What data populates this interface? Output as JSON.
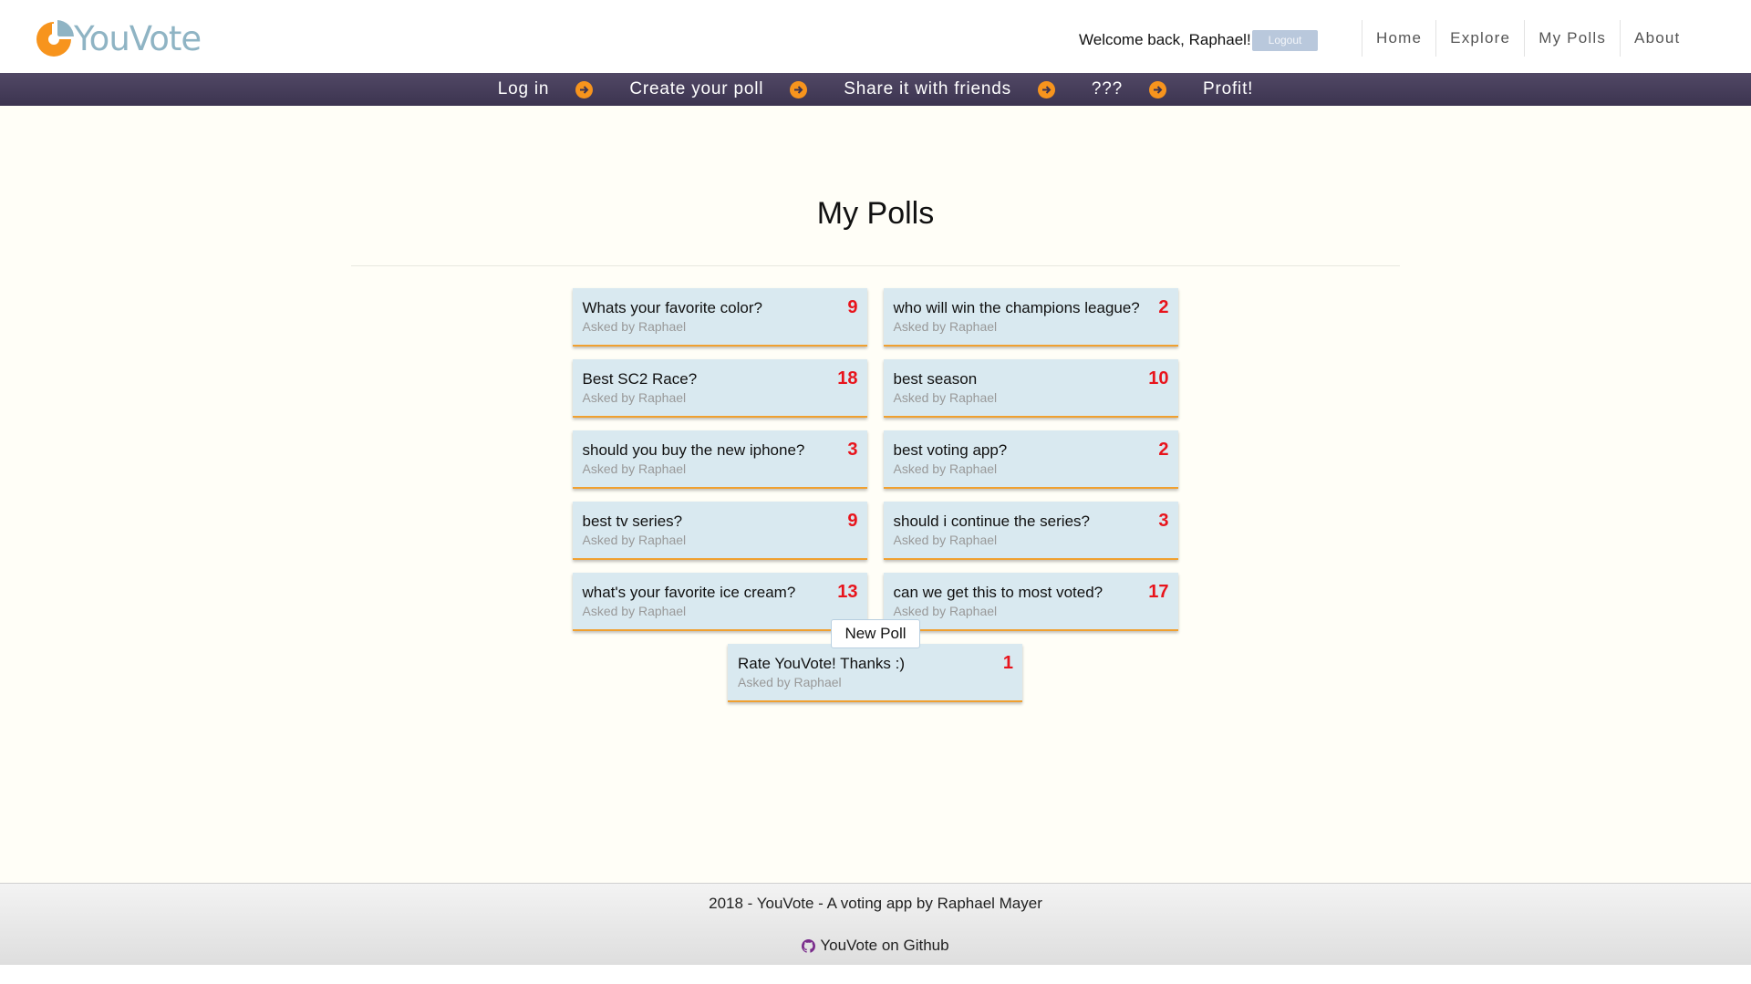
{
  "brand": {
    "name": "YouVote",
    "accent": "#f7941d",
    "logo_text_color": "#8fb4c4"
  },
  "header": {
    "welcome": "Welcome back, Raphael!",
    "logout_label": "Logout",
    "nav": [
      "Home",
      "Explore",
      "My Polls",
      "About"
    ]
  },
  "steps": [
    "Log in",
    "Create your poll",
    "Share it with friends",
    "???",
    "Profit!"
  ],
  "main": {
    "title": "My Polls",
    "new_poll_label": "New Poll",
    "polls": [
      {
        "question": "Whats your favorite color?",
        "author": "Asked by Raphael",
        "votes": "9"
      },
      {
        "question": "who will win the champions league?",
        "author": "Asked by Raphael",
        "votes": "2"
      },
      {
        "question": "Best SC2 Race?",
        "author": "Asked by Raphael",
        "votes": "18"
      },
      {
        "question": "best season",
        "author": "Asked by Raphael",
        "votes": "10"
      },
      {
        "question": "should you buy the new iphone?",
        "author": "Asked by Raphael",
        "votes": "3"
      },
      {
        "question": "best voting app?",
        "author": "Asked by Raphael",
        "votes": "2"
      },
      {
        "question": "best tv series?",
        "author": "Asked by Raphael",
        "votes": "9"
      },
      {
        "question": "should i continue the series?",
        "author": "Asked by Raphael",
        "votes": "3"
      },
      {
        "question": "what's your favorite ice cream?",
        "author": "Asked by Raphael",
        "votes": "13"
      },
      {
        "question": "can we get this to most voted?",
        "author": "Asked by Raphael",
        "votes": "17"
      },
      {
        "question": "Rate YouVote! Thanks :)",
        "author": "Asked by Raphael",
        "votes": "1"
      }
    ]
  },
  "footer": {
    "text": "2018 - YouVote - A voting app by Raphael Mayer",
    "github_link": "YouVote on Github",
    "github_icon": "github-icon"
  }
}
